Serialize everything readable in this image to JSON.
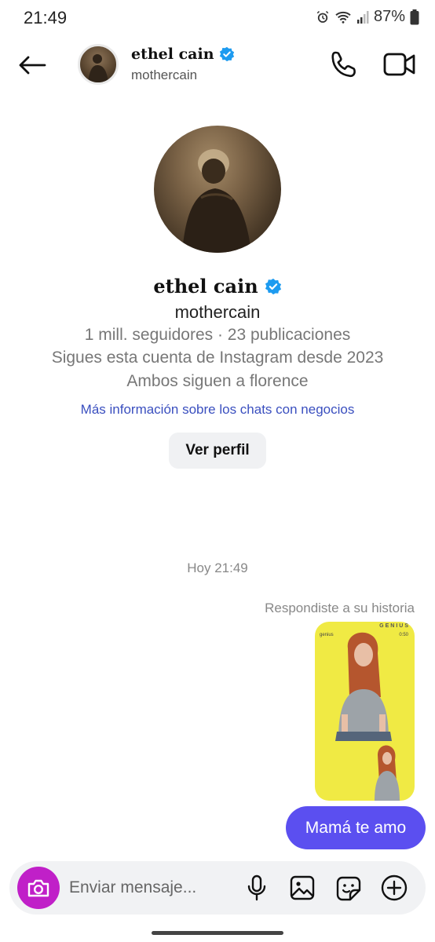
{
  "status_bar": {
    "time": "21:49",
    "battery_text": "87%",
    "icons": [
      "alarm-icon",
      "wifi-icon",
      "signal-icon",
      "battery-icon"
    ]
  },
  "header": {
    "name": "ethel cain",
    "username": "mothercain",
    "verified": true,
    "icons": [
      "back-arrow-icon",
      "phone-icon",
      "video-camera-icon"
    ]
  },
  "profile": {
    "name": "ethel cain",
    "username": "mothercain",
    "stats": "1 mill. seguidores · 23 publicaciones",
    "following_since": "Sigues esta cuenta de Instagram desde 2023",
    "mutual": "Ambos siguen a florence",
    "business_link": "Más información sobre los chats con negocios",
    "view_profile_label": "Ver perfil"
  },
  "chat": {
    "timestamp": "Hoy 21:49",
    "reply_label": "Respondiste a su historia",
    "story_brand": "GENIUS",
    "story_left": "genius",
    "story_right": "0:50",
    "message": "Mamá te amo"
  },
  "composer": {
    "placeholder": "Enviar mensaje...",
    "icons": [
      "camera-icon",
      "microphone-icon",
      "gallery-icon",
      "sticker-icon",
      "add-icon"
    ]
  },
  "colors": {
    "accent": "#5b4ff0",
    "camera": "#c020c8",
    "link": "#3a4fbf",
    "verified": "#1d9bf0",
    "story_bg": "#f0ea44"
  }
}
